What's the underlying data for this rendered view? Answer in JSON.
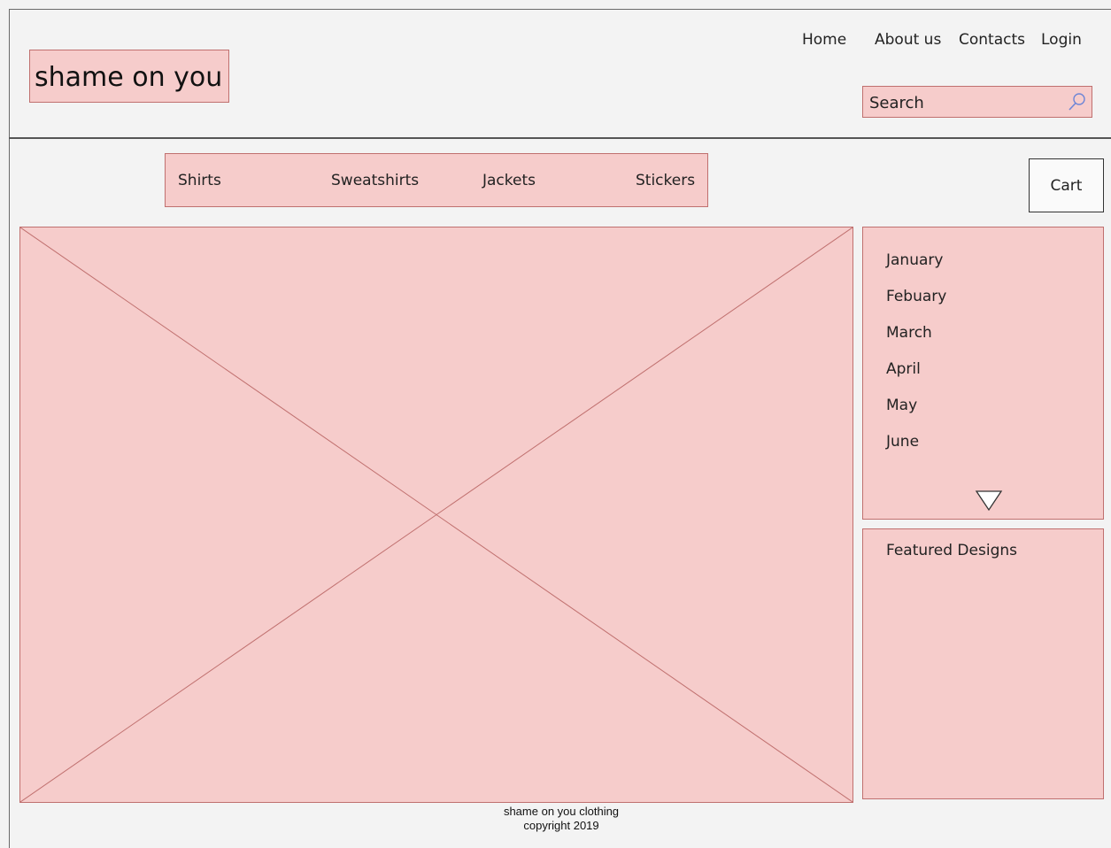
{
  "brand": {
    "logo_text": "shame on you"
  },
  "top_nav": [
    "Home",
    "About us",
    "Contacts",
    "Login"
  ],
  "search": {
    "placeholder": "Search"
  },
  "categories": [
    "Shirts",
    "Sweatshirts",
    "Jackets",
    "Stickers"
  ],
  "cart": {
    "label": "Cart"
  },
  "archive": {
    "months": [
      "January",
      "Febuary",
      "March",
      "April",
      "May",
      "June"
    ]
  },
  "featured": {
    "title": "Featured Designs"
  },
  "footer": {
    "line1": "shame on you clothing",
    "line2": "copyright 2019"
  },
  "colors": {
    "accent_fill": "#f6cccb",
    "accent_border": "#c0706f",
    "background": "#f3f3f3",
    "search_icon": "#6e86d6"
  }
}
